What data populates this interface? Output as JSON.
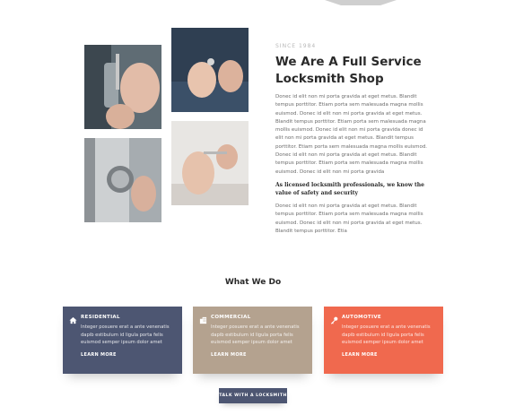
{
  "colors": {
    "residential": "#4d5672",
    "commercial": "#b4a28f",
    "automotive": "#f0694e",
    "cta": "#4d5672",
    "heading": "#2a2a2a"
  },
  "photos": [
    {
      "icon": "key-in-lock-photo"
    },
    {
      "icon": "hands-with-key-photo"
    },
    {
      "icon": "door-knob-photo"
    },
    {
      "icon": "lock-cylinder-photo"
    }
  ],
  "about": {
    "kicker": "SINCE 1984",
    "title": "We Are A Full Service Locksmith Shop",
    "paragraph1": "Donec id elit non mi porta gravida at eget metus. Blandit tempus porttitor. Etiam porta sem malesuada magna mollis euismod. Donec id elit non mi porta gravida at eget metus. Blandit tempus porttitor. Etiam porta sem malesuada magna mollis euismod. Donec id elit non mi porta gravida donec id elit non mi porta gravida at eget metus. Blandit tempus porttitor. Etiam porta sem malesuada magna mollis euismod. Donec id elit non mi porta gravida at eget metus. Blandit tempus porttitor. Etiam porta sem malesuada magna mollis euismod. Donec id elit non mi porta gravida",
    "lead": "As licensed locksmith professionals, we know the value of safety and security",
    "paragraph2": "Donec id elit non mi porta gravida at eget metus. Blandit tempus porttitor. Etiam porta sem malesuada magna mollis euismod. Donec id elit non mi porta gravida at eget metus. Blandit tempus porttitor. Etia"
  },
  "services": {
    "title": "What We Do",
    "cards": [
      {
        "title": "RESIDENTIAL",
        "icon": "home-icon",
        "text": "Integer posuere erat a ante venenatis dapib estibulum id ligula porta felis euismod semper ipsum dolor amet",
        "link": "LEARN MORE"
      },
      {
        "title": "COMMERCIAL",
        "icon": "building-icon",
        "text": "Integer posuere erat a ante venenatis dapib estibulum id ligula porta felis euismod semper ipsum dolor amet",
        "link": "LEARN MORE"
      },
      {
        "title": "AUTOMOTIVE",
        "icon": "car-key-icon",
        "text": "Integer posuere erat a ante venenatis dapib estibulum id ligula porta felis euismod semper ipsum dolor amet",
        "link": "LEARN MORE"
      }
    ]
  },
  "cta": {
    "label": "TALK WITH A LOCKSMITH"
  }
}
